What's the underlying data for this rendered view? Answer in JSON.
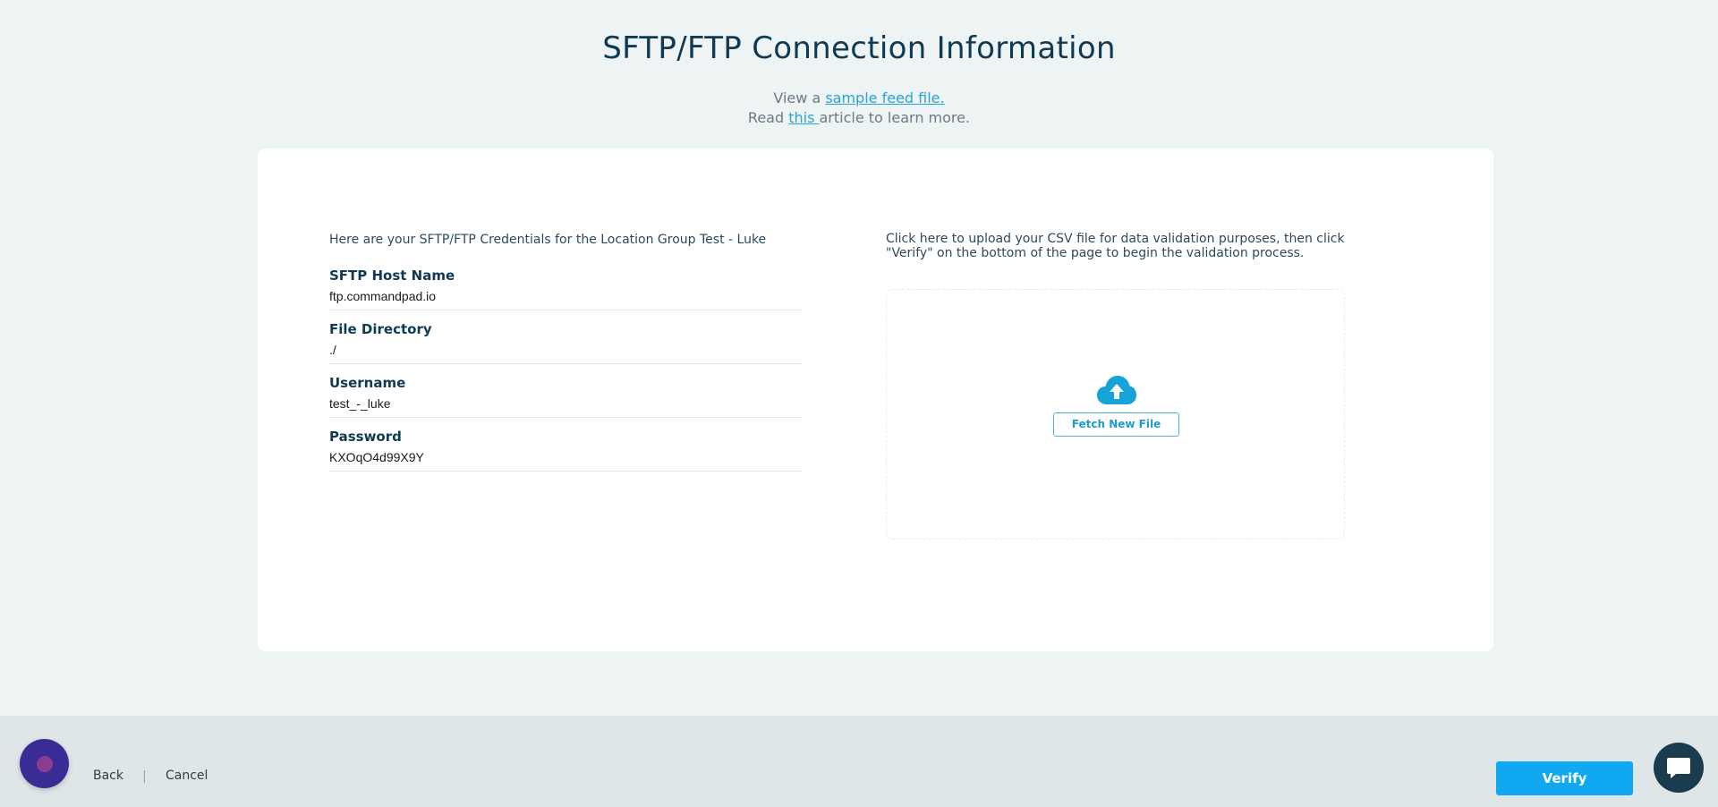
{
  "header": {
    "title": "SFTP/FTP Connection Information",
    "sample_prefix": "View a ",
    "sample_link": "sample feed file.",
    "read_prefix": "Read ",
    "read_link": "this ",
    "read_suffix": "article to learn more."
  },
  "credentials": {
    "intro": "Here are your SFTP/FTP Credentials for the Location Group Test - Luke",
    "fields": [
      {
        "label": "SFTP Host Name",
        "value": "ftp.commandpad.io"
      },
      {
        "label": "File Directory",
        "value": "./"
      },
      {
        "label": "Username",
        "value": "test_-_luke"
      },
      {
        "label": "Password",
        "value": "KXOqO4d99X9Y"
      }
    ]
  },
  "upload": {
    "instructions": "Click here to upload your CSV file for data validation purposes, then click \"Verify\" on the bottom of the page to begin the validation process.",
    "fetch_label": "Fetch New File",
    "icon": "cloud-upload-icon"
  },
  "footer": {
    "back_label": "Back",
    "separator": "|",
    "cancel_label": "Cancel",
    "verify_label": "Verify",
    "avatar_icon": "avatar-icon",
    "chat_icon": "chat-bubble-icon"
  },
  "colors": {
    "accent": "#10a8f0",
    "link": "#2aa3d6",
    "title": "#0f3a52",
    "background": "#eef3f4",
    "footer": "#dfe6e8",
    "chat": "#1b3b4e",
    "avatar": "#3a2c95"
  }
}
